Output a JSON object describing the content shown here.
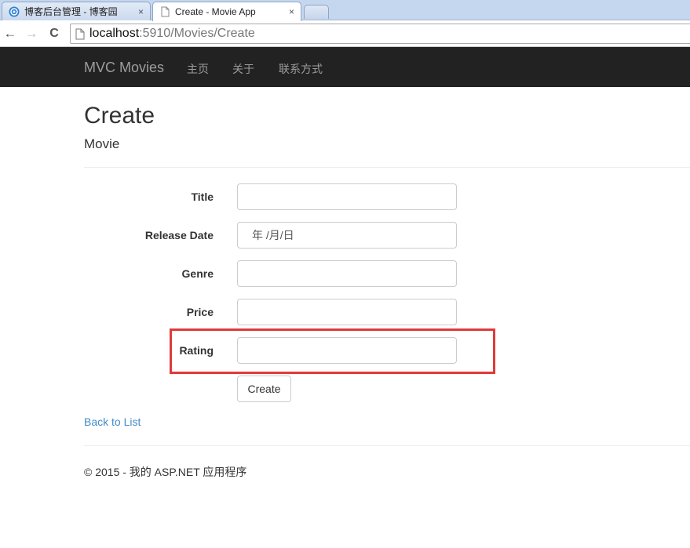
{
  "browser": {
    "tabs": [
      {
        "title": "博客后台管理 - 博客园",
        "active": false
      },
      {
        "title": "Create - Movie App",
        "active": true
      }
    ],
    "close_glyph": "×",
    "nav": {
      "back": "←",
      "forward": "→",
      "reload": "C"
    },
    "url_host": "localhost",
    "url_rest": ":5910/Movies/Create"
  },
  "navbar": {
    "brand": "MVC Movies",
    "links": [
      "主页",
      "关于",
      "联系方式"
    ]
  },
  "page": {
    "title": "Create",
    "subtitle": "Movie"
  },
  "form": {
    "fields": [
      {
        "label": "Title",
        "value": ""
      },
      {
        "label": "Release Date",
        "value": "年 /月/日"
      },
      {
        "label": "Genre",
        "value": ""
      },
      {
        "label": "Price",
        "value": ""
      },
      {
        "label": "Rating",
        "value": ""
      }
    ],
    "submit_label": "Create"
  },
  "back_link": "Back to List",
  "footer": "© 2015 - 我的 ASP.NET 应用程序",
  "colors": {
    "navbar_bg": "#222222",
    "link": "#428bca",
    "highlight_border": "#e03a3a"
  }
}
